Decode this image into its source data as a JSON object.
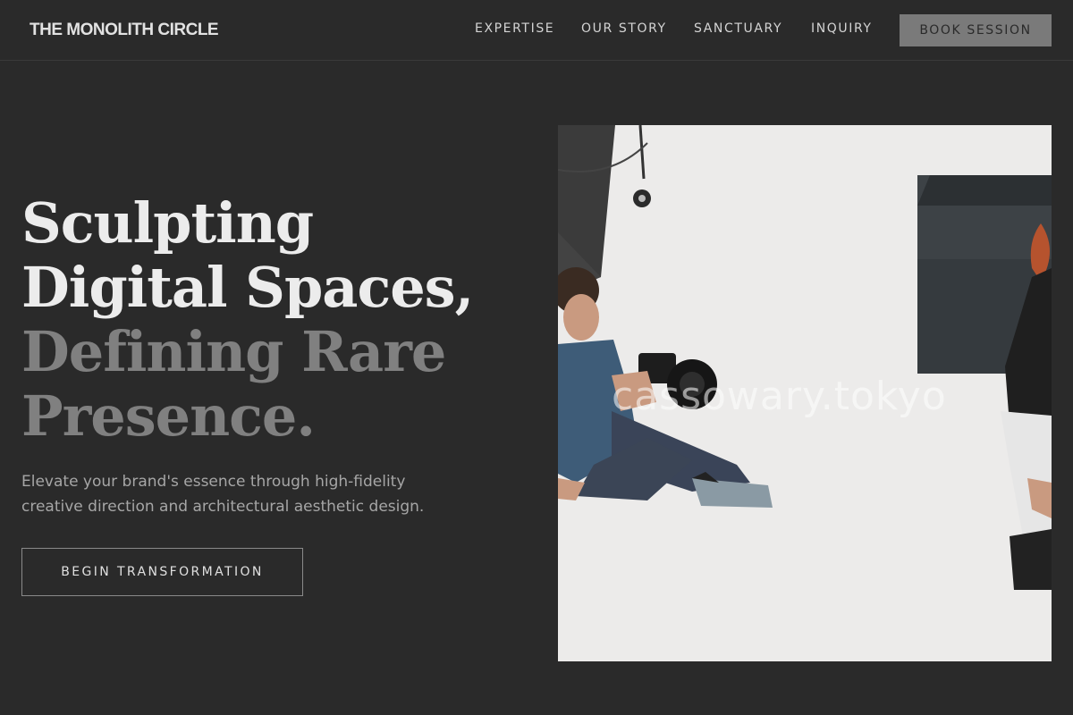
{
  "header": {
    "brand": "THE MONOLITH CIRCLE",
    "nav": [
      "EXPERTISE",
      "OUR STORY",
      "SANCTUARY",
      "INQUIRY"
    ],
    "cta_label": "BOOK SESSION"
  },
  "hero": {
    "headline_lines": [
      "Sculpting",
      "Digital Spaces,",
      "Defining Rare",
      "Presence."
    ],
    "subtitle": "Elevate your brand's essence through high-fidelity creative direction and architectural aesthetic design.",
    "cta_label": "BEGIN TRANSFORMATION"
  },
  "image": {
    "watermark": "cassowary.tokyo"
  },
  "colors": {
    "background": "#2a2a2a",
    "headline_light": "#ececec",
    "headline_dim": "#808080",
    "book_button": "#7a7a7a"
  }
}
